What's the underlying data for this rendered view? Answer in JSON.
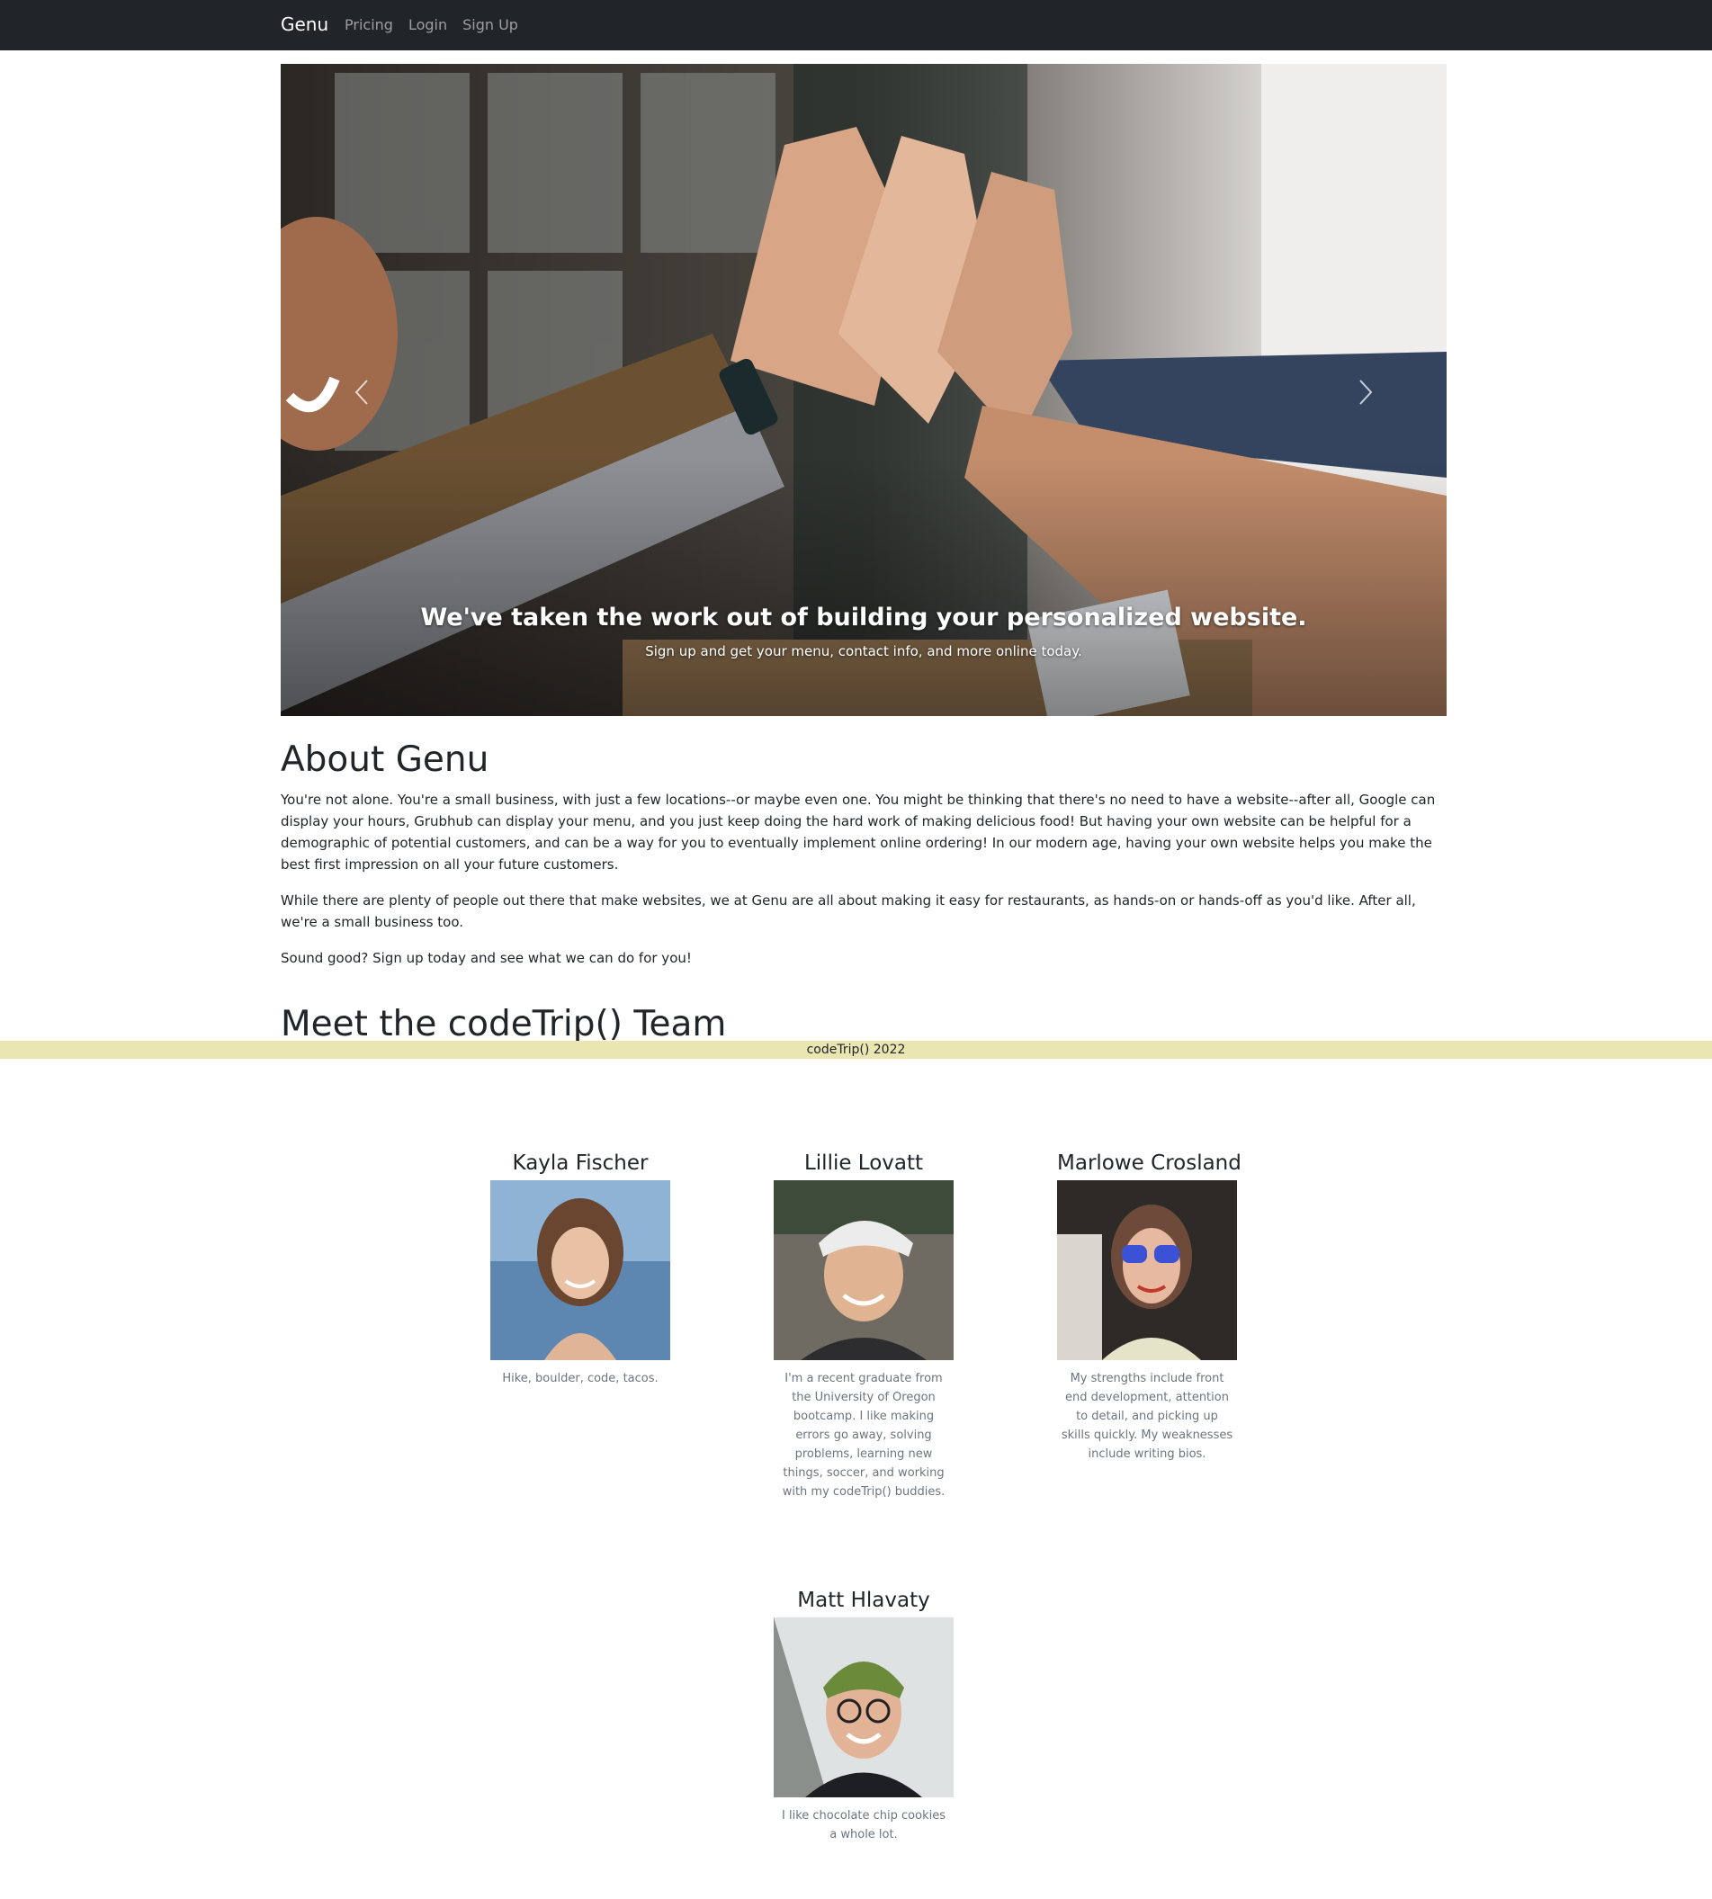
{
  "navbar": {
    "brand": "Genu",
    "links": [
      "Pricing",
      "Login",
      "Sign Up"
    ]
  },
  "carousel": {
    "caption_title": "We've taken the work out of building your personalized website.",
    "caption_text": "Sign up and get your menu, contact info, and more online today.",
    "prev_icon": "chevron-left-icon",
    "next_icon": "chevron-right-icon"
  },
  "about": {
    "title": "About Genu",
    "paragraphs": [
      "You're not alone. You're a small business, with just a few locations--or maybe even one. You might be thinking that there's no need to have a website--after all, Google can display your hours, Grubhub can display your menu, and you just keep doing the hard work of making delicious food! But having your own website can be helpful for a demographic of potential customers, and can be a way for you to eventually implement online ordering! In our modern age, having your own website helps you make the best first impression on all your future customers.",
      "While there are plenty of people out there that make websites, we at Genu are all about making it easy for restaurants, as hands-on or hands-off as you'd like. After all, we're a small business too.",
      "Sound good? Sign up today and see what we can do for you!"
    ]
  },
  "team": {
    "title": "Meet the codeTrip() Team",
    "members": [
      {
        "name": "Kayla Fischer",
        "bio": "Hike, boulder, code, tacos."
      },
      {
        "name": "Lillie Lovatt",
        "bio": "I'm a recent graduate from the University of Oregon bootcamp. I like making errors go away, solving problems, learning new things, soccer, and working with my codeTrip() buddies."
      },
      {
        "name": "Marlowe Crosland",
        "bio": "My strengths include front end development, attention to detail, and picking up skills quickly. My weaknesses include writing bios."
      },
      {
        "name": "Matt Hlavaty",
        "bio": "I like chocolate chip cookies a whole lot."
      }
    ]
  },
  "footer": {
    "text": "codeTrip() 2022"
  },
  "colors": {
    "navbar": "#212529",
    "footer": "#eae6b2",
    "muted": "#6c757d"
  }
}
